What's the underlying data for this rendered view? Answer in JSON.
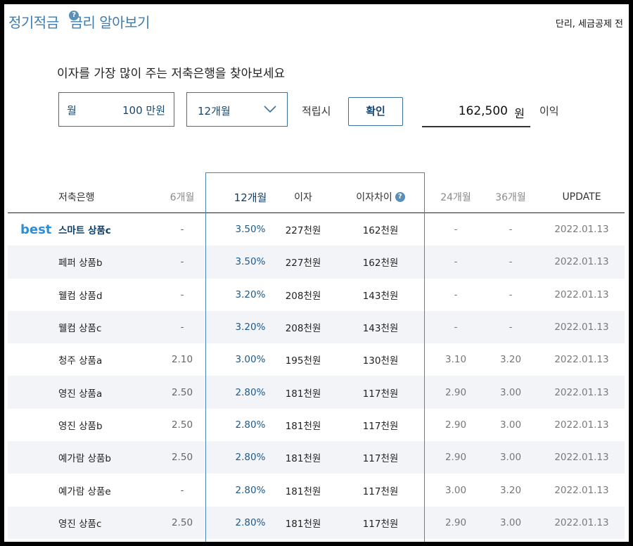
{
  "header": {
    "title_part1": "정기적금",
    "title_part2": "금리 알아보기",
    "help": "?",
    "note": "단리, 세금공제 전"
  },
  "search": {
    "subtitle": "이자를 가장 많이 주는 저축은행을 찾아보세요",
    "monthly_label": "월",
    "monthly_value": "100 만원",
    "period_value": "12개월",
    "accum_label": "적립시",
    "confirm_label": "확인",
    "result_value": "162,500",
    "result_unit": "원",
    "interest_label": "이익"
  },
  "table": {
    "headers": {
      "bank": "저축은행",
      "m6": "6개월",
      "m12": "12개월",
      "interest": "이자",
      "diff": "이자차이",
      "m24": "24개월",
      "m36": "36개월",
      "update": "UPDATE"
    },
    "best_label": "best",
    "rows": [
      {
        "name": "스마트 상품c",
        "m6": "-",
        "m12": "3.50%",
        "interest": "227천원",
        "diff": "162천원",
        "m24": "-",
        "m36": "-",
        "update": "2022.01.13"
      },
      {
        "name": "페퍼 상품b",
        "m6": "-",
        "m12": "3.50%",
        "interest": "227천원",
        "diff": "162천원",
        "m24": "-",
        "m36": "-",
        "update": "2022.01.13"
      },
      {
        "name": "웰컴 상품d",
        "m6": "-",
        "m12": "3.20%",
        "interest": "208천원",
        "diff": "143천원",
        "m24": "-",
        "m36": "-",
        "update": "2022.01.13"
      },
      {
        "name": "웰컴 상품c",
        "m6": "-",
        "m12": "3.20%",
        "interest": "208천원",
        "diff": "143천원",
        "m24": "-",
        "m36": "-",
        "update": "2022.01.13"
      },
      {
        "name": "청주 상품a",
        "m6": "2.10",
        "m12": "3.00%",
        "interest": "195천원",
        "diff": "130천원",
        "m24": "3.10",
        "m36": "3.20",
        "update": "2022.01.13"
      },
      {
        "name": "영진 상품a",
        "m6": "2.50",
        "m12": "2.80%",
        "interest": "181천원",
        "diff": "117천원",
        "m24": "2.90",
        "m36": "3.00",
        "update": "2022.01.13"
      },
      {
        "name": "영진 상품b",
        "m6": "2.50",
        "m12": "2.80%",
        "interest": "181천원",
        "diff": "117천원",
        "m24": "2.90",
        "m36": "3.00",
        "update": "2022.01.13"
      },
      {
        "name": "예가람 상품b",
        "m6": "2.50",
        "m12": "2.80%",
        "interest": "181천원",
        "diff": "117천원",
        "m24": "2.90",
        "m36": "3.00",
        "update": "2022.01.13"
      },
      {
        "name": "예가람 상품e",
        "m6": "-",
        "m12": "2.80%",
        "interest": "181천원",
        "diff": "117천원",
        "m24": "3.00",
        "m36": "3.20",
        "update": "2022.01.13"
      },
      {
        "name": "영진 상품c",
        "m6": "2.50",
        "m12": "2.80%",
        "interest": "181천원",
        "diff": "117천원",
        "m24": "2.90",
        "m36": "3.00",
        "update": "2022.01.13"
      }
    ]
  }
}
